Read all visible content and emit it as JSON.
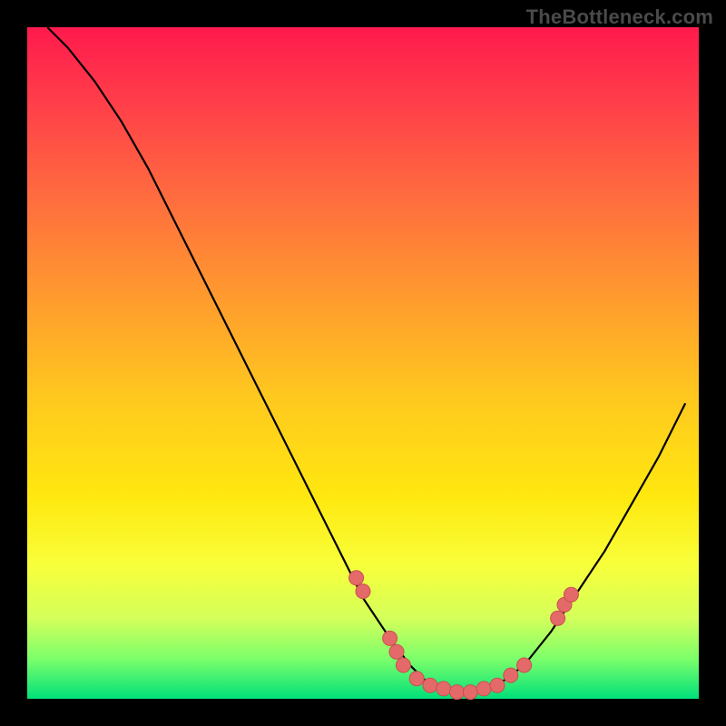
{
  "watermark": "TheBottleneck.com",
  "colors": {
    "curve": "#000000",
    "dot": "#e46a6a",
    "dot_stroke": "#c94f4f"
  },
  "chart_data": {
    "type": "line",
    "title": "",
    "xlabel": "",
    "ylabel": "",
    "xlim": [
      0,
      100
    ],
    "ylim": [
      0,
      100
    ],
    "series": [
      {
        "name": "bottleneck-curve",
        "x": [
          3,
          6,
          10,
          14,
          18,
          22,
          26,
          30,
          34,
          38,
          42,
          46,
          50,
          54,
          57,
          60,
          63,
          66,
          70,
          74,
          78,
          82,
          86,
          90,
          94,
          98
        ],
        "y": [
          100,
          97,
          92,
          86,
          79,
          71,
          63,
          55,
          47,
          39,
          31,
          23,
          15,
          9,
          5,
          2,
          1,
          1,
          2,
          5,
          10,
          16,
          22,
          29,
          36,
          44
        ]
      }
    ],
    "scatter": [
      {
        "name": "highlight-dots",
        "points": [
          [
            49,
            18
          ],
          [
            50,
            16
          ],
          [
            54,
            9
          ],
          [
            55,
            7
          ],
          [
            56,
            5
          ],
          [
            58,
            3
          ],
          [
            60,
            2
          ],
          [
            62,
            1.5
          ],
          [
            64,
            1
          ],
          [
            66,
            1
          ],
          [
            68,
            1.5
          ],
          [
            70,
            2
          ],
          [
            72,
            3.5
          ],
          [
            74,
            5
          ],
          [
            79,
            12
          ],
          [
            80,
            14
          ],
          [
            81,
            15.5
          ]
        ]
      }
    ]
  }
}
